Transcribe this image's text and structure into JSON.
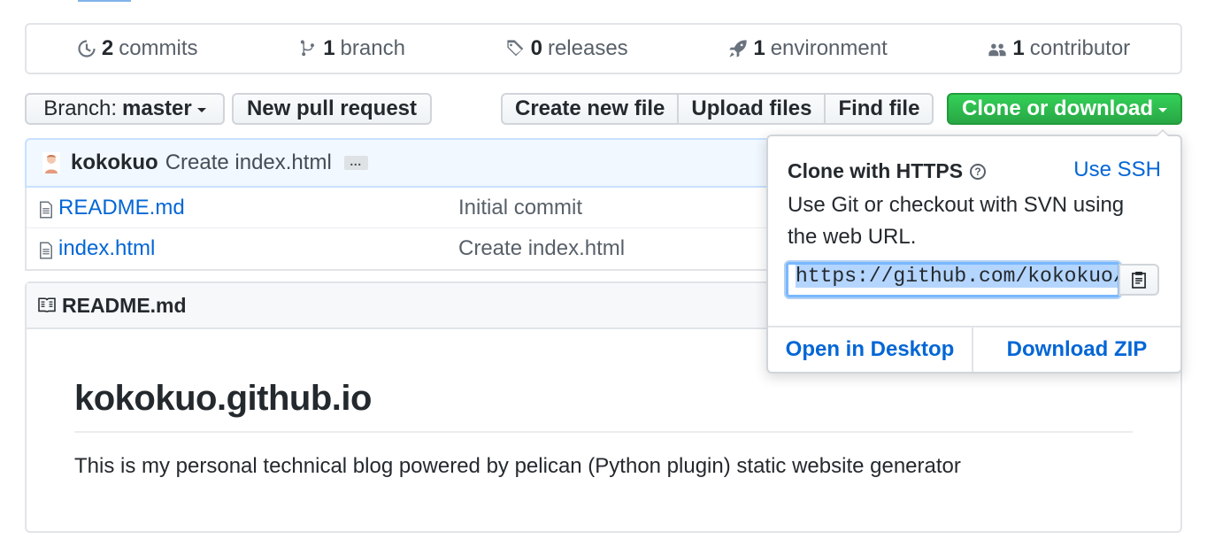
{
  "summary": {
    "commits_num": "2",
    "commits_label": "commits",
    "branch_num": "1",
    "branch_label": "branch",
    "releases_num": "0",
    "releases_label": "releases",
    "env_num": "1",
    "env_label": "environment",
    "contrib_num": "1",
    "contrib_label": "contributor"
  },
  "toolbar": {
    "branch_prefix": "Branch:",
    "branch_name": "master",
    "new_pr": "New pull request",
    "create_file": "Create new file",
    "upload_files": "Upload files",
    "find_file": "Find file",
    "clone": "Clone or download"
  },
  "commit": {
    "author": "kokokuo",
    "message": "Create index.html",
    "ellipsis": "…"
  },
  "files": [
    {
      "name": "README.md",
      "message": "Initial commit"
    },
    {
      "name": "index.html",
      "message": "Create index.html"
    }
  ],
  "readme": {
    "header": "README.md",
    "title": "kokokuo.github.io",
    "text": "This is my personal technical blog powered by pelican (Python plugin) static website generator"
  },
  "clone_popup": {
    "title": "Clone with HTTPS",
    "help": "?",
    "use_ssh": "Use SSH",
    "description": "Use Git or checkout with SVN using the web URL.",
    "url": "https://github.com/kokokuo/kokokuo.github.io.git",
    "open_desktop": "Open in Desktop",
    "download_zip": "Download ZIP"
  },
  "colors": {
    "accent": "#0366d6",
    "clone_green": "#28a745",
    "commit_bar": "#f1f8ff"
  }
}
